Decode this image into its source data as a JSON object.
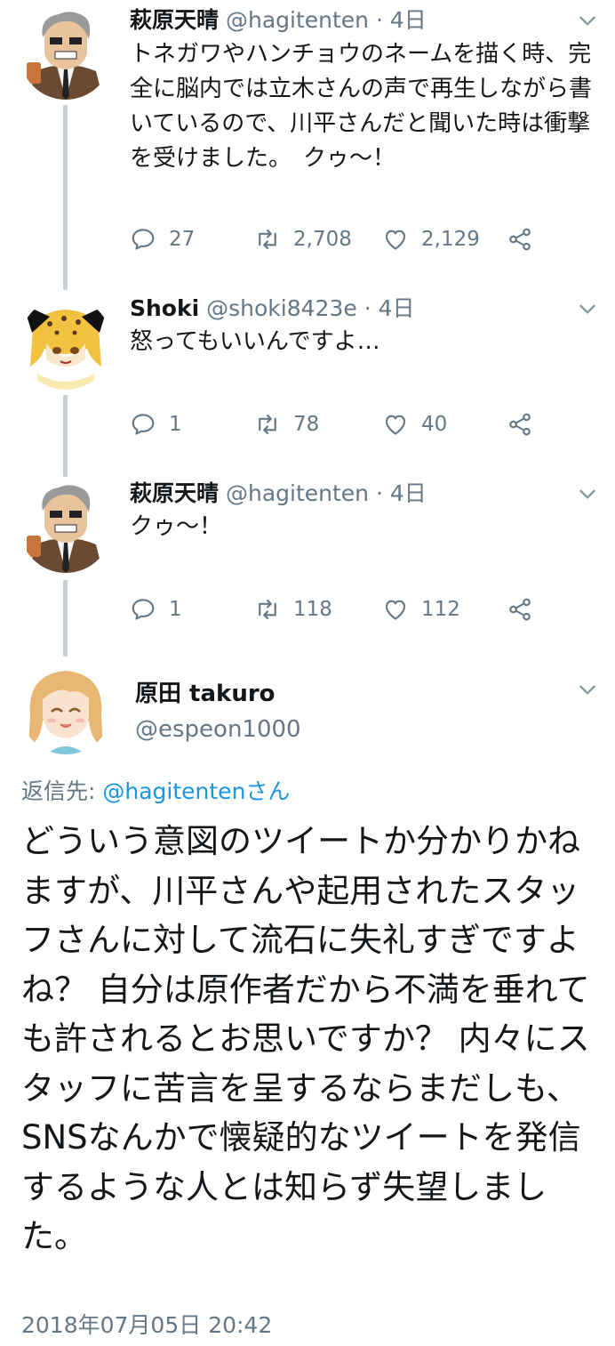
{
  "tweets": [
    {
      "name": "萩原天晴",
      "handle": "@hagitenten",
      "sep": "·",
      "date": "4日",
      "body": "トネガワやハンチョウのネームを描く時、完全に脳内では立木さんの声で再生しながら書いているので、川平さんだと聞いた時は衝撃を受けました。　クゥ～！",
      "replies": "27",
      "retweets": "2,708",
      "likes": "2,129"
    },
    {
      "name": "Shoki",
      "handle": "@shoki8423e",
      "sep": "·",
      "date": "4日",
      "body": "怒ってもいいんですよ…",
      "replies": "1",
      "retweets": "78",
      "likes": "40"
    },
    {
      "name": "萩原天晴",
      "handle": "@hagitenten",
      "sep": "·",
      "date": "4日",
      "body": "クゥ～！",
      "replies": "1",
      "retweets": "118",
      "likes": "112"
    }
  ],
  "main_tweet": {
    "name": "原田 takuro",
    "handle": "@espeon1000",
    "reply_prefix": "返信先: ",
    "reply_mention": "@hagitentenさん",
    "body": "どういう意図のツイートか分かりかねますが、川平さんや起用されたスタッフさんに対して流石に失礼すぎですよね？ 自分は原作者だから不満を垂れても許されるとお思いですか？ 内々にスタッフに苦言を呈するならまだしも、SNSなんかで懐疑的なツイートを発信するような人とは知らず失望しました。",
    "timestamp": "2018年07月05日 20:42"
  },
  "icons": {
    "reply": "speech-bubble-icon",
    "retweet": "retweet-arrows-icon",
    "like": "heart-icon",
    "share": "share-icon",
    "menu": "chevron-down-icon"
  },
  "colors": {
    "text": "#14171a",
    "secondary": "#657786",
    "link": "#1b95e0",
    "thread_line": "#c4cfd6"
  }
}
